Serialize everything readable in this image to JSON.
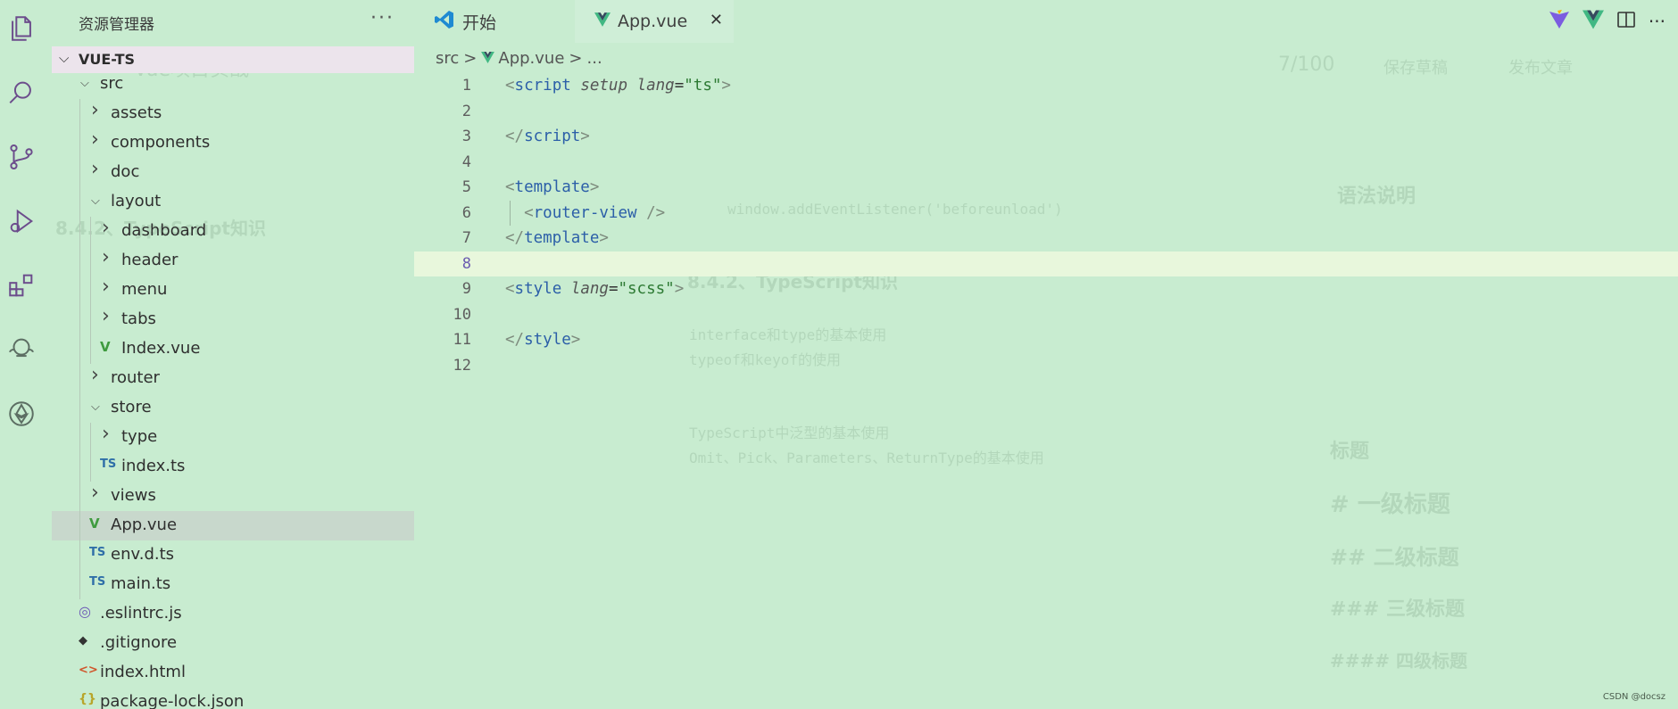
{
  "sidebar": {
    "title": "资源管理器",
    "more": "···",
    "root": "VUE-TS",
    "rows": [
      {
        "name": "src",
        "depth": 1,
        "type": "folder-open"
      },
      {
        "name": "assets",
        "depth": 2,
        "type": "folder"
      },
      {
        "name": "components",
        "depth": 2,
        "type": "folder"
      },
      {
        "name": "doc",
        "depth": 2,
        "type": "folder"
      },
      {
        "name": "layout",
        "depth": 2,
        "type": "folder-open"
      },
      {
        "name": "dashboard",
        "depth": 3,
        "type": "folder"
      },
      {
        "name": "header",
        "depth": 3,
        "type": "folder"
      },
      {
        "name": "menu",
        "depth": 3,
        "type": "folder"
      },
      {
        "name": "tabs",
        "depth": 3,
        "type": "folder"
      },
      {
        "name": "Index.vue",
        "depth": 3,
        "type": "vue"
      },
      {
        "name": "router",
        "depth": 2,
        "type": "folder"
      },
      {
        "name": "store",
        "depth": 2,
        "type": "folder-open"
      },
      {
        "name": "type",
        "depth": 3,
        "type": "folder"
      },
      {
        "name": "index.ts",
        "depth": 3,
        "type": "ts"
      },
      {
        "name": "views",
        "depth": 2,
        "type": "folder"
      },
      {
        "name": "App.vue",
        "depth": 2,
        "type": "vue",
        "selected": true
      },
      {
        "name": "env.d.ts",
        "depth": 2,
        "type": "ts"
      },
      {
        "name": "main.ts",
        "depth": 2,
        "type": "ts"
      },
      {
        "name": ".eslintrc.js",
        "depth": 1,
        "type": "eslint"
      },
      {
        "name": ".gitignore",
        "depth": 1,
        "type": "git"
      },
      {
        "name": "index.html",
        "depth": 1,
        "type": "html"
      },
      {
        "name": "package-lock.json",
        "depth": 1,
        "type": "json"
      }
    ]
  },
  "tabs": {
    "start_label": "开始",
    "app_label": "App.vue",
    "close": "✕"
  },
  "breadcrumb": [
    "src",
    ">",
    "App.vue",
    ">",
    "..."
  ],
  "editor": {
    "active_line": 8,
    "line_numbers": [
      "1",
      "2",
      "3",
      "4",
      "5",
      "6",
      "7",
      "8",
      "9",
      "10",
      "11",
      "12"
    ]
  },
  "watermark": "CSDN @docsz",
  "colors": {
    "background": "#c8ecd0",
    "active_line": "#e8f7dc",
    "tag": "#2c5fa8",
    "string": "#2d7a33",
    "vue_icon": "#3f9b3f",
    "ts_icon": "#2f6fa8"
  },
  "ghost": {
    "title": "Vue项目实战",
    "count": "7/100",
    "save_draft": "保存草稿",
    "publish": "发布文章",
    "section_ts": "8.4.2、TypeScript知识",
    "section_ts2": "8.4.2、TypeScript知识",
    "help_title": "语法说明",
    "heading": "标题",
    "h1": "# 一级标题",
    "h2": "## 二级标题",
    "h3": "### 三级标题",
    "h4": "#### 四级标题",
    "code1": "window.addEventListener('beforeunload')",
    "code2": "interface和type的基本使用",
    "code3": "typeof和keyof的使用",
    "code4": "TypeScript中泛型的基本使用",
    "code5": "Omit、Pick、Parameters、ReturnType的基本使用"
  }
}
